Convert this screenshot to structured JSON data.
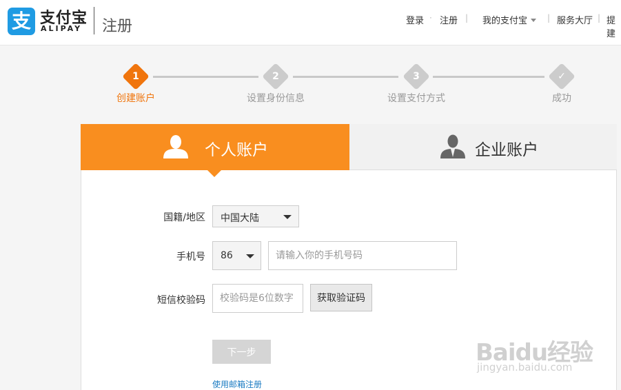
{
  "header": {
    "logo_icon_char": "支",
    "logo_cn": "支付宝",
    "logo_en": "ALIPAY",
    "page_title": "注册",
    "nav": {
      "login": "登录",
      "sep": "·",
      "register": "注册",
      "bar": "|",
      "my_alipay": "我的支付宝",
      "service_hall": "服务大厅",
      "more": "提建"
    }
  },
  "steps": [
    {
      "num": "1",
      "label": "创建账户",
      "active": true
    },
    {
      "num": "2",
      "label": "设置身份信息",
      "active": false
    },
    {
      "num": "3",
      "label": "设置支付方式",
      "active": false
    },
    {
      "num": "✓",
      "label": "成功",
      "active": false
    }
  ],
  "tabs": {
    "personal": "个人账户",
    "enterprise": "企业账户"
  },
  "form": {
    "nationality_label": "国籍/地区",
    "nationality_value": "中国大陆",
    "phone_label": "手机号",
    "country_code": "86",
    "phone_placeholder": "请输入你的手机号码",
    "sms_label": "短信校验码",
    "sms_placeholder": "校验码是6位数字",
    "sms_button": "获取验证码",
    "next_button": "下一步",
    "email_link": "使用邮箱注册"
  },
  "watermark": {
    "big": "Baidu经验",
    "small": "jingyan.baidu.com"
  },
  "colors": {
    "brand_blue": "#1f9be3",
    "accent_orange": "#f98e1f",
    "step_orange": "#f0750d",
    "link_blue": "#1a7bc2"
  }
}
